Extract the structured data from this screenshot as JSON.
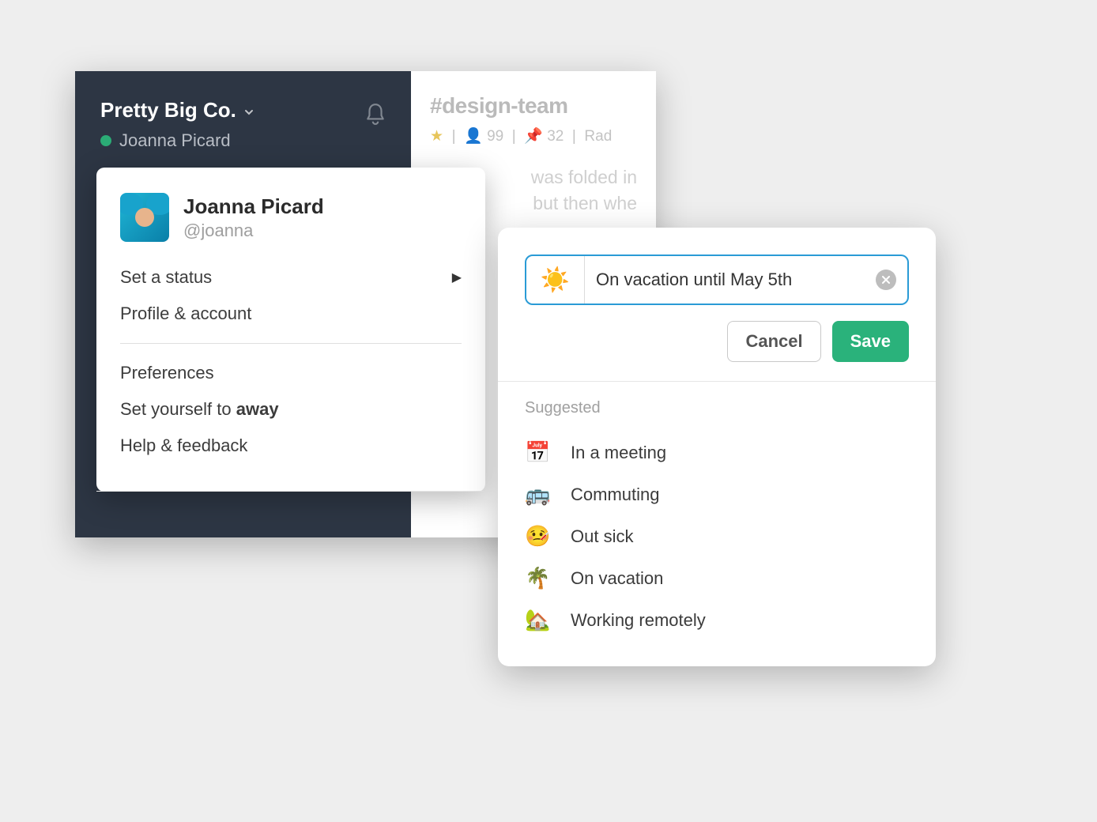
{
  "sidebar": {
    "workspace": "Pretty Big Co.",
    "user": "Joanna Picard"
  },
  "channel": {
    "name": "#design-team",
    "members": "99",
    "pins": "32",
    "topic": "Rad",
    "body1": "was folded in",
    "body2": "but then whe"
  },
  "dropdown": {
    "fullName": "Joanna Picard",
    "handle": "@joanna",
    "setStatus": "Set a status",
    "profileAccount": "Profile & account",
    "preferences": "Preferences",
    "setAwayPrefix": "Set yourself to ",
    "setAwayBold": "away",
    "helpFeedback": "Help & feedback"
  },
  "statusDialog": {
    "emoji": "☀️",
    "value": "On vacation until May 5th",
    "cancel": "Cancel",
    "save": "Save",
    "suggestedLabel": "Suggested",
    "suggestions": {
      "meeting": {
        "emoji": "📅",
        "label": "In a meeting"
      },
      "commuting": {
        "emoji": "🚌",
        "label": "Commuting"
      },
      "sick": {
        "emoji": "🤒",
        "label": "Out sick"
      },
      "vacation": {
        "emoji": "🌴",
        "label": "On vacation"
      },
      "remote": {
        "emoji": "🏡",
        "label": "Working remotely"
      }
    }
  }
}
